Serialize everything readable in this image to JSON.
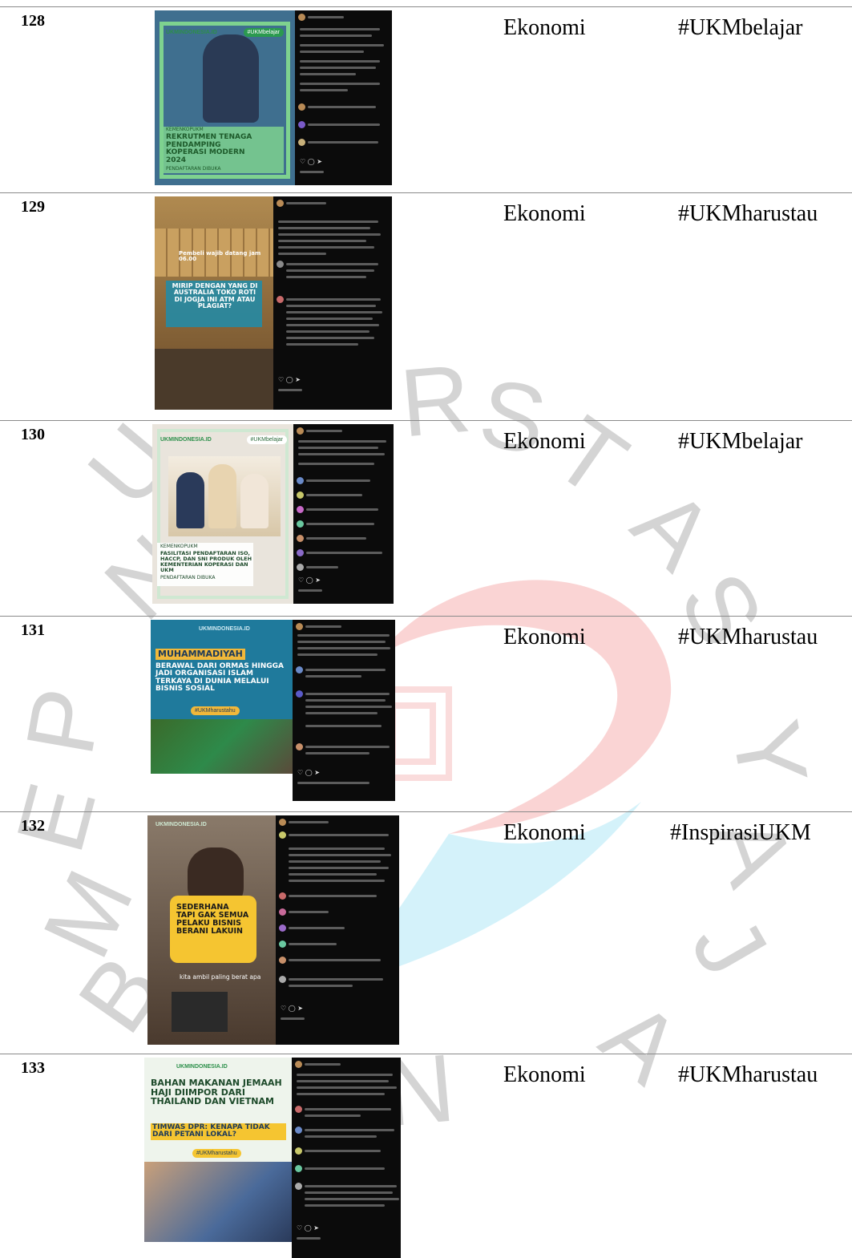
{
  "rows": [
    {
      "number": "128",
      "category": "Ekonomi",
      "hashtag": "#UKMbelajar",
      "post": {
        "brand": "UKMINDONESIA.ID",
        "badge": "#UKMbelajar",
        "kicker": "KEMENKOPUKM",
        "headline": "REKRUTMEN TENAGA PENDAMPING KOPERASI MODERN 2024",
        "sub": "PENDAFTARAN DIBUKA",
        "bg": "#3f6f8f",
        "frame": "#7ed28f",
        "text_color": "#1d5a2a"
      }
    },
    {
      "number": "129",
      "category": "Ekonomi",
      "hashtag": "#UKMharustau",
      "post": {
        "brand": "",
        "badge": "",
        "kicker": "Pembeli wajib datang jam 06.00",
        "headline": "MIRIP DENGAN YANG DI AUSTRALIA TOKO ROTI DI JOGJA INI ATM ATAU PLAGIAT?",
        "sub": "",
        "bg": "#8a6a3e",
        "frame": "",
        "text_color": "#ffffff"
      }
    },
    {
      "number": "130",
      "category": "Ekonomi",
      "hashtag": "#UKMbelajar",
      "post": {
        "brand": "UKMINDONESIA.ID",
        "badge": "#UKMbelajar",
        "kicker": "KEMENKOPUKM",
        "headline": "FASILITASI PENDAFTARAN ISO, HACCP, DAN SNI PRODUK OLEH KEMENTERIAN KOPERASI DAN UKM",
        "sub": "PENDAFTARAN DIBUKA",
        "bg": "#e9e4dc",
        "frame": "",
        "text_color": "#1d4a2a"
      }
    },
    {
      "number": "131",
      "category": "Ekonomi",
      "hashtag": "#UKMharustau",
      "post": {
        "brand": "UKMINDONESIA.ID",
        "badge": "#UKMharustahu",
        "kicker": "MUHAMMADIYAH",
        "headline": "BERAWAL DARI ORMAS HINGGA JADI ORGANISASI ISLAM TERKAYA DI DUNIA MELALUI BISNIS SOSIAL",
        "sub": "",
        "bg": "#1f7a9c",
        "frame": "",
        "text_color": "#ffffff"
      }
    },
    {
      "number": "132",
      "category": "Ekonomi",
      "hashtag": "#InspirasiUKM",
      "post": {
        "brand": "UKMINDONESIA.ID",
        "badge": "",
        "kicker": "",
        "headline": "SEDERHANA TAPI GAK SEMUA PELAKU BISNIS BERANI LAKUIN",
        "sub": "kita ambil paling berat apa",
        "bg": "#5d4a3a",
        "frame": "",
        "text_color": "#1a1a1a"
      }
    },
    {
      "number": "133",
      "category": "Ekonomi",
      "hashtag": "#UKMharustau",
      "post": {
        "brand": "UKMINDONESIA.ID",
        "badge": "#UKMharustahu",
        "kicker": "",
        "headline": "BAHAN MAKANAN JEMAAH HAJI DIIMPOR DARI THAILAND DAN VIETNAM",
        "sub": "TIMWAS DPR: KENAPA TIDAK DARI PETANI LOKAL?",
        "bg": "#eef4ec",
        "frame": "",
        "text_color": "#1d4a2a"
      }
    }
  ],
  "watermark": {
    "letters": [
      "U",
      "N",
      "I",
      "V",
      "E",
      "R",
      "S",
      "I",
      "T",
      "A",
      "S",
      "P",
      "E",
      "M",
      "B",
      "A",
      "N",
      "G",
      "U",
      "N",
      "A",
      "N",
      "J",
      "A",
      "Y",
      "A"
    ]
  }
}
